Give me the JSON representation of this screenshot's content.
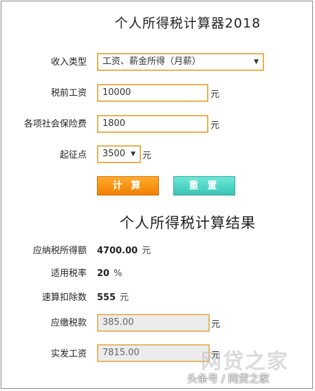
{
  "title": "个人所得税计算器2018",
  "form": {
    "income_type": {
      "label": "收入类型",
      "value": "工资、薪金所得（月薪）"
    },
    "pretax_salary": {
      "label": "税前工资",
      "value": "10000",
      "unit": "元"
    },
    "social_insurance": {
      "label": "各项社会保险费",
      "value": "1800",
      "unit": "元"
    },
    "threshold": {
      "label": "起征点",
      "value": "3500",
      "unit": "元"
    }
  },
  "buttons": {
    "calculate": "计 算",
    "reset": "重 置"
  },
  "result_title": "个人所得税计算结果",
  "results": {
    "taxable_income": {
      "label": "应纳税所得额",
      "value": "4700.00",
      "unit": "元"
    },
    "tax_rate": {
      "label": "适用税率",
      "value": "20",
      "unit": "%"
    },
    "quick_deduction": {
      "label": "速算扣除数",
      "value": "555",
      "unit": "元"
    },
    "tax_payable": {
      "label": "应缴税款",
      "value": "385.00",
      "unit": "元"
    },
    "net_salary": {
      "label": "实发工资",
      "value": "7815.00",
      "unit": "元"
    }
  },
  "watermark": {
    "logo": "网贷之家",
    "credit": "头条号 / 网贷之家"
  },
  "icons": {
    "dropdown": "chevron-down-icon"
  },
  "colors": {
    "field_border": "#e8b14f",
    "calc_button": "#f59a1a",
    "reset_button": "#4fd4c4"
  }
}
